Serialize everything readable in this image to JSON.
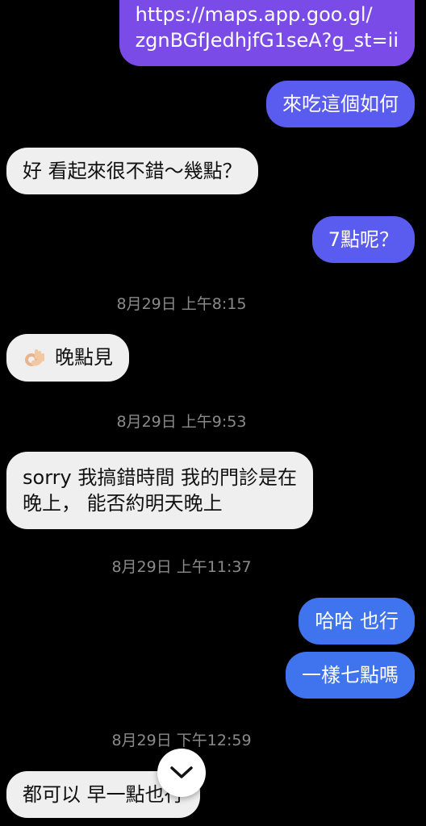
{
  "messages": [
    {
      "id": "m1",
      "side": "outgoing",
      "lines": [
        "https://maps.app.goo.gl/",
        "zgnBGfJedhjfG1seA?g_st=ii"
      ]
    },
    {
      "id": "m2",
      "side": "outgoing",
      "text": "來吃這個如何"
    },
    {
      "id": "m3",
      "side": "incoming",
      "text": "好 看起來很不錯～幾點？"
    },
    {
      "id": "m4",
      "side": "outgoing",
      "text": "7點呢？"
    },
    {
      "id": "t1",
      "type": "timestamp",
      "text": "8月29日 上午8:15"
    },
    {
      "id": "m5",
      "side": "incoming",
      "text": "晚點見",
      "emoji": "ok-hand-icon"
    },
    {
      "id": "t2",
      "type": "timestamp",
      "text": "8月29日 上午9:53"
    },
    {
      "id": "m6",
      "side": "incoming",
      "lines": [
        "sorry 我搞錯時間 我的門診是在",
        "晚上， 能否約明天晚上"
      ]
    },
    {
      "id": "t3",
      "type": "timestamp",
      "text": "8月29日 上午11:37"
    },
    {
      "id": "m7",
      "side": "outgoing",
      "text": "哈哈 也行"
    },
    {
      "id": "m8",
      "side": "outgoing",
      "text": "一樣七點嗎"
    },
    {
      "id": "t4",
      "type": "timestamp",
      "text": "8月29日 下午12:59"
    },
    {
      "id": "m9",
      "side": "incoming",
      "text": "都可以 早一點也行"
    }
  ],
  "scroll_button": {
    "icon": "chevron-down-icon"
  },
  "colors": {
    "background": "#000000",
    "incoming_bubble": "#efefef",
    "outgoing_purple": "#7b4be8",
    "outgoing_indigo": "#5a5cf0",
    "outgoing_blue": "#3f74ee",
    "timestamp_text": "#8a8a8a"
  }
}
